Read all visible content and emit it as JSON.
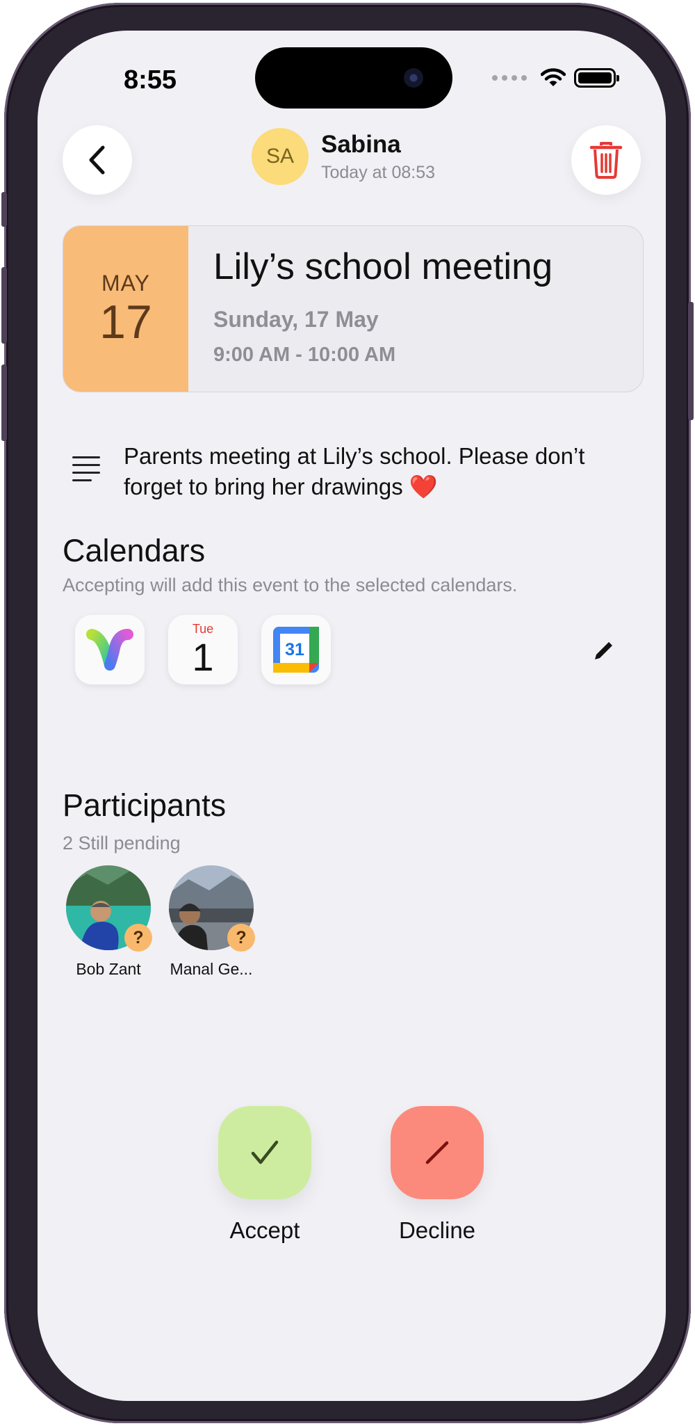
{
  "status_bar": {
    "time": "8:55"
  },
  "header": {
    "sender_initials": "SA",
    "sender_name": "Sabina",
    "sent_time": "Today at 08:53"
  },
  "event": {
    "month": "MAY",
    "day": "17",
    "title": "Lily’s school meeting",
    "date": "Sunday, 17 May",
    "time": "9:00 AM - 10:00 AM",
    "accent_color": "#f9bb78"
  },
  "description": "Parents meeting at Lily’s school. Please don’t forget to bring her drawings ❤️",
  "calendars": {
    "title": "Calendars",
    "subtitle": "Accepting will add this event to the selected calendars.",
    "items": [
      {
        "icon": "app-logo-icon"
      },
      {
        "icon": "apple-calendar-icon",
        "weekday": "Tue",
        "day": "1"
      },
      {
        "icon": "google-calendar-icon",
        "day": "31"
      }
    ]
  },
  "participants": {
    "title": "Participants",
    "subtitle": "2 Still pending",
    "people": [
      {
        "name": "Bob Zant",
        "status": "?"
      },
      {
        "name": "Manal Ge...",
        "status": "?"
      }
    ]
  },
  "actions": {
    "accept_label": "Accept",
    "decline_label": "Decline",
    "accept_color": "#cdeca0",
    "decline_color": "#fb8a7c"
  }
}
